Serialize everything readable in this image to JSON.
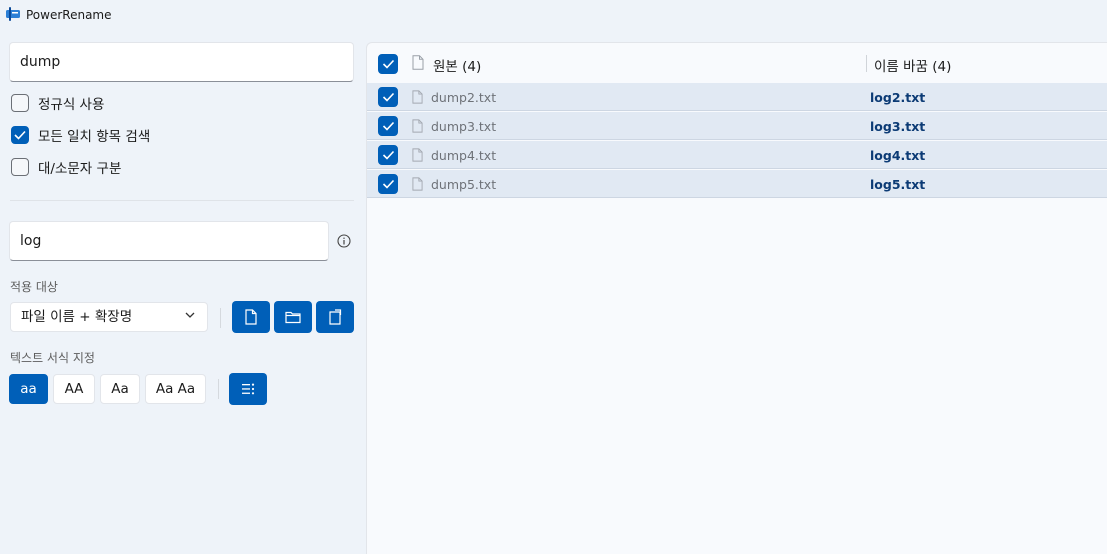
{
  "window": {
    "title": "PowerRename"
  },
  "search": {
    "value": "dump"
  },
  "options": {
    "regex": {
      "label": "정규식 사용",
      "checked": false
    },
    "match_all": {
      "label": "모든 일치 항목 검색",
      "checked": true
    },
    "case_sensitive": {
      "label": "대/소문자 구분",
      "checked": false
    }
  },
  "replace": {
    "value": "log"
  },
  "apply_to": {
    "label": "적용 대상",
    "selected": "파일 이름 + 확장명",
    "icons": [
      "file-icon",
      "folder-icon",
      "subfolder-icon"
    ]
  },
  "text_format": {
    "label": "텍스트 서식 지정",
    "buttons": [
      "aa",
      "AA",
      "Aa",
      "Aa Aa"
    ],
    "active": "aa"
  },
  "list": {
    "original_header": "원본 (4)",
    "renamed_header": "이름 바꿈 (4)",
    "rows": [
      {
        "original": "dump2.txt",
        "renamed": "log2.txt"
      },
      {
        "original": "dump3.txt",
        "renamed": "log3.txt"
      },
      {
        "original": "dump4.txt",
        "renamed": "log4.txt"
      },
      {
        "original": "dump5.txt",
        "renamed": "log5.txt"
      }
    ]
  },
  "colors": {
    "accent": "#005fb8",
    "background": "#eef3f9",
    "row_highlight": "#e1e9f3"
  }
}
